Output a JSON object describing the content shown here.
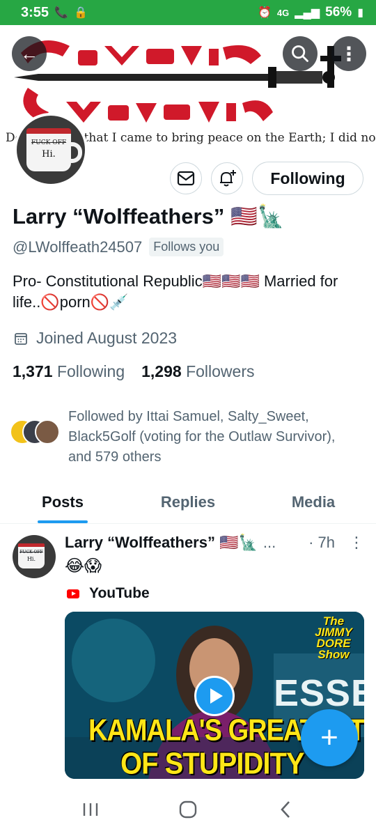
{
  "status_bar": {
    "time": "3:55",
    "network": "4G",
    "battery": "56%"
  },
  "banner": {
    "quote": "Do not think that I came to bring peace on the Earth; I did not"
  },
  "avatar": {
    "mug_text_top": "FUCK OFF",
    "mug_text_bottom": "Hi."
  },
  "profile": {
    "follow_button": "Following",
    "name": "Larry “Wolffeathers” 🇺🇸🗽",
    "handle": "@LWolffeath24507",
    "follows_you": "Follows you",
    "bio": "Pro- Constitutional Republic🇺🇸🇺🇸🇺🇸 Married for life..🚫porn🚫💉",
    "joined": "Joined August 2023",
    "following_count": "1,371",
    "following_label": "Following",
    "followers_count": "1,298",
    "followers_label": "Followers",
    "followed_by": "Followed by Ittai Samuel, Salty_Sweet, Black5Golf (voting for the Outlaw Survivor), and 579 others"
  },
  "tabs": [
    {
      "label": "Posts",
      "active": true
    },
    {
      "label": "Replies",
      "active": false
    },
    {
      "label": "Media",
      "active": false
    }
  ],
  "post": {
    "author": "Larry “Wolffeathers” 🇺🇸🗽",
    "ellipsis": "...",
    "time": "· 7h",
    "more": "⋮",
    "text": "😂😱",
    "source": "YouTube",
    "avatar_mug_top": "FUCK OFF",
    "avatar_mug_bottom": "Hi.",
    "thumbnail": {
      "line1": "KAMALA'S GREATEST H",
      "line2": "OF STUPIDITY",
      "bg_word": "ESSEN",
      "show_badge": "The JIMMY DORE Show"
    }
  },
  "colors": {
    "accent": "#1d9bf0",
    "status_bar": "#27a744",
    "text_secondary": "#536471"
  }
}
